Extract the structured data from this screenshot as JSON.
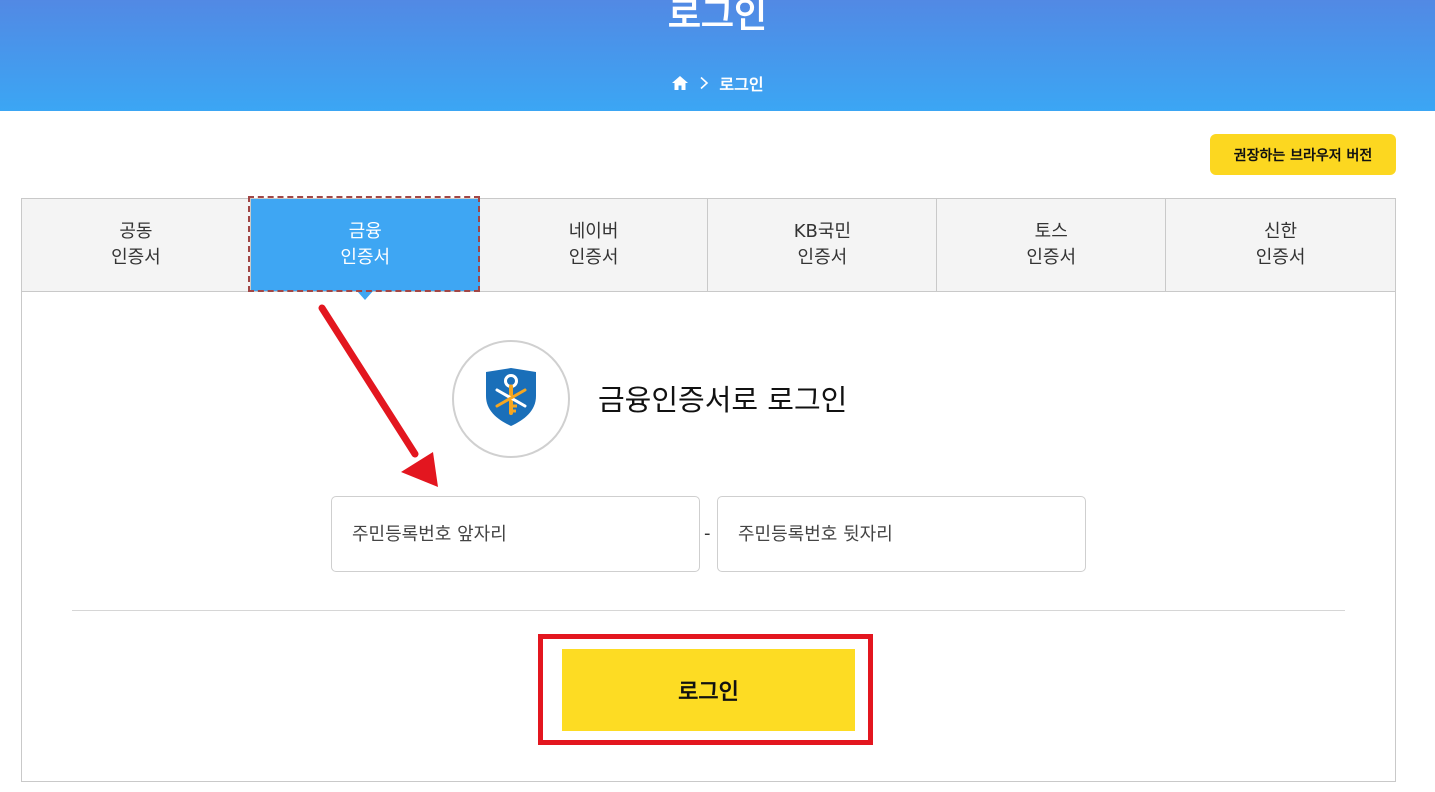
{
  "header": {
    "title": "로그인",
    "breadcrumb": {
      "home_icon": "home-icon",
      "separator_icon": "chevron-right-icon",
      "current": "로그인"
    }
  },
  "browser_button": {
    "label": "권장하는 브라우저 버전"
  },
  "tabs": [
    {
      "line1": "공동",
      "line2": "인증서",
      "active": false
    },
    {
      "line1": "금융",
      "line2": "인증서",
      "active": true
    },
    {
      "line1": "네이버",
      "line2": "인증서",
      "active": false
    },
    {
      "line1": "KB국민",
      "line2": "인증서",
      "active": false
    },
    {
      "line1": "토스",
      "line2": "인증서",
      "active": false
    },
    {
      "line1": "신한",
      "line2": "인증서",
      "active": false
    }
  ],
  "login_section": {
    "logo_icon": "financial-certificate-shield-key-icon",
    "heading": "금융인증서로 로그인",
    "front_placeholder": "주민등록번호 앞자리",
    "separator": "-",
    "back_placeholder": "주민등록번호 뒷자리",
    "login_label": "로그인"
  },
  "annotations": {
    "arrow_color": "#e3161f",
    "highlight_color": "#e3161f"
  },
  "colors": {
    "header_top": "#5289e4",
    "header_bottom": "#3ba6f4",
    "active_tab": "#3ea6f3",
    "button_yellow": "#fddc23"
  }
}
